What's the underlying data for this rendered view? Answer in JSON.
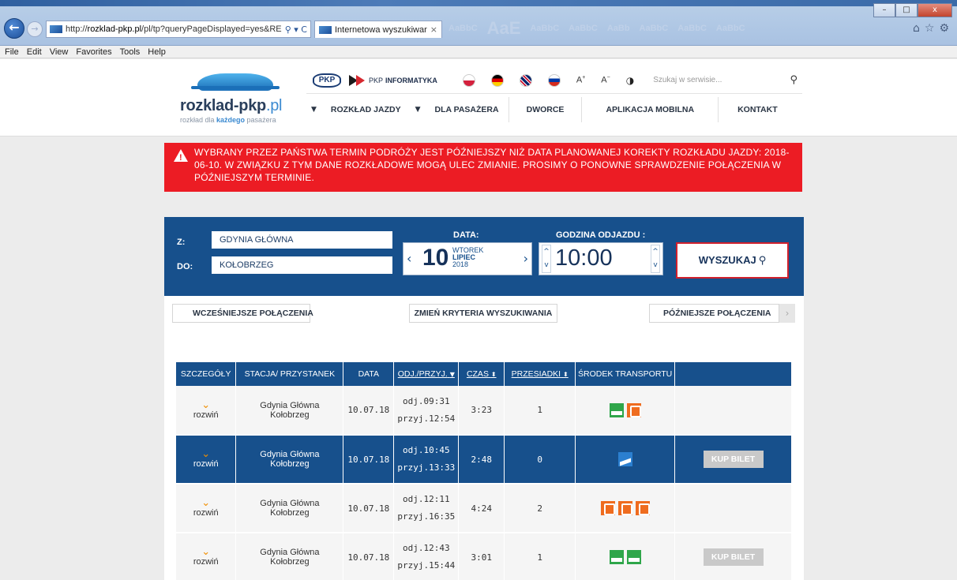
{
  "browser": {
    "url_host": "rozklad-pkp.pl",
    "url_prefix": "http://",
    "url_suffix": "/pl/tp?queryPageDisplayed=yes&RE",
    "url_controls": "⚲ ▾ C",
    "tab_title": "Internetowa wyszukiwarka ...",
    "tab_close": "×",
    "menu": [
      "File",
      "Edit",
      "View",
      "Favorites",
      "Tools",
      "Help"
    ],
    "window_buttons": [
      "–",
      "□",
      "x"
    ],
    "tool_icons": [
      "⌂",
      "☆",
      "⚙"
    ],
    "back_icon": "←",
    "forward_icon": "→"
  },
  "header": {
    "logo_name": "rozklad-pkp",
    "logo_tld": ".pl",
    "logo_tag_pre": "rozkład dla ",
    "logo_tag_bold": "każdego",
    "logo_tag_post": " pasażera",
    "pkp_logo": "PKP",
    "pkp_informatyka_pre": "PKP",
    "pkp_informatyka_bold": "INFORMATYKA",
    "font_increase": "A",
    "font_increase_sup": "+",
    "font_decrease": "A",
    "font_decrease_sup": "−",
    "contrast_icon": "◑",
    "search_placeholder": "Szukaj w serwisie...",
    "search_icon": "⚲",
    "nav": {
      "caret": "▼",
      "rozklad": "ROZKŁAD JAZDY",
      "pasazer": "DLA PASAŻERA",
      "dworce": "DWORCE",
      "aplikacja": "APLIKACJA MOBILNA",
      "kontakt": "KONTAKT"
    }
  },
  "alert": {
    "text": "WYBRANY PRZEZ PAŃSTWA TERMIN PODRÓŻY JEST PÓŹNIEJSZY NIŻ DATA PLANOWANEJ KOREKTY ROZKŁADU JAZDY: 2018-06-10. W ZWIĄZKU Z TYM DANE ROZKŁADOWE MOGĄ ULEC ZMIANIE. PROSIMY O PONOWNE SPRAWDZENIE POŁĄCZENIA W PÓŹNIEJSZYM TERMINIE."
  },
  "search": {
    "from_label": "Z:",
    "from_value": "GDYNIA GŁÓWNA",
    "to_label": "DO:",
    "to_value": "KOŁOBRZEG",
    "date_label": "DATA:",
    "date_day": "10",
    "date_weekday": "WTOREK",
    "date_month": "LIPIEC",
    "date_year": "2018",
    "prev_arrow": "‹",
    "next_arrow": "›",
    "time_label": "GODZINA ODJAZDU :",
    "time_value": "10:00",
    "spin_up": "^",
    "spin_down": "v",
    "button": "WYSZUKAJ",
    "button_icon": "⚲"
  },
  "results": {
    "earlier": "WCZEŚNIEJSZE POŁĄCZENIA",
    "change": "ZMIEŃ KRYTERIA WYSZUKIWANIA",
    "later": "PÓŹNIEJSZE POŁĄCZENIA",
    "left_arrow": "‹",
    "right_arrow": "›",
    "headers": {
      "details": "SZCZEGÓŁY",
      "station": "STACJA/ PRZYSTANEK",
      "date": "DATA",
      "times": "ODJ./PRZYJ.",
      "duration": "CZAS",
      "changes": "PRZESIADKI",
      "transport": "ŚRODEK TRANSPORTU",
      "sort_down": "▼",
      "sort_both": "⬍"
    },
    "expand_icon": "⌄",
    "expand_label": "rozwiń",
    "buy_label": "KUP BILET",
    "rows": [
      {
        "from": "Gdynia Główna",
        "to": "Kołobrzeg",
        "date": "10.07.18",
        "dep": "odj.09:31",
        "arr": "przyj.12:54",
        "duration": "3:23",
        "changes": "1",
        "transport": [
          "tlk",
          "regio"
        ],
        "buy": false,
        "highlight": false
      },
      {
        "from": "Gdynia Główna",
        "to": "Kołobrzeg",
        "date": "10.07.18",
        "dep": "odj.10:45",
        "arr": "przyj.13:33",
        "duration": "2:48",
        "changes": "0",
        "transport": [
          "eip"
        ],
        "buy": true,
        "highlight": true
      },
      {
        "from": "Gdynia Główna",
        "to": "Kołobrzeg",
        "date": "10.07.18",
        "dep": "odj.12:11",
        "arr": "przyj.16:35",
        "duration": "4:24",
        "changes": "2",
        "transport": [
          "regio",
          "regio",
          "regio"
        ],
        "buy": false,
        "highlight": false
      },
      {
        "from": "Gdynia Główna",
        "to": "Kołobrzeg",
        "date": "10.07.18",
        "dep": "odj.12:43",
        "arr": "przyj.15:44",
        "duration": "3:01",
        "changes": "1",
        "transport": [
          "tlk",
          "tlk"
        ],
        "buy": true,
        "highlight": false
      }
    ]
  }
}
